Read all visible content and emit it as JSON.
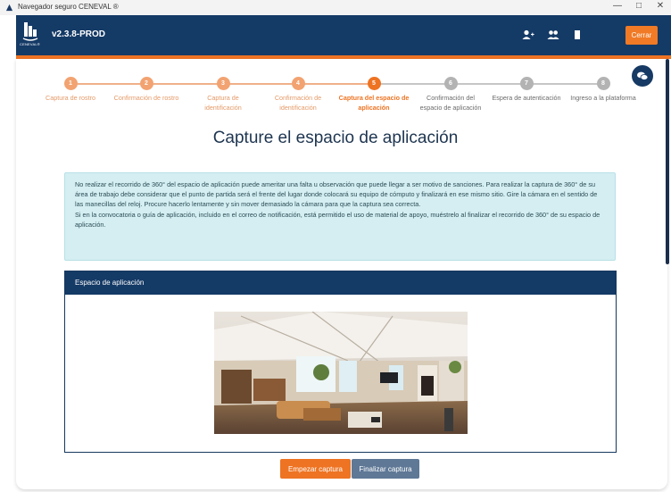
{
  "window": {
    "title": "Navegador seguro CENEVAL ®",
    "min_icon": "—",
    "restore_icon": "□",
    "close_icon": "✕"
  },
  "header": {
    "logo_text": "CENEVAL®",
    "version": "v2.3.8-PROD",
    "close_label": "Cerrar"
  },
  "steps": [
    {
      "number": "1",
      "label": "Captura de rostro",
      "status": "done"
    },
    {
      "number": "2",
      "label": "Confirmación de rostro",
      "status": "done"
    },
    {
      "number": "3",
      "label": "Captura de identificación",
      "status": "done"
    },
    {
      "number": "4",
      "label": "Confirmación de identificación",
      "status": "done"
    },
    {
      "number": "5",
      "label": "Captura del espacio de aplicación",
      "status": "active"
    },
    {
      "number": "6",
      "label": "Confirmación del espacio de aplicación",
      "status": "pending"
    },
    {
      "number": "7",
      "label": "Espera de autenticación",
      "status": "pending"
    },
    {
      "number": "8",
      "label": "Ingreso a la plataforma",
      "status": "pending"
    }
  ],
  "page_title": "Capture el espacio de aplicación",
  "alert": {
    "paragraph1": "No realizar el recorrido de 360° del espacio de aplicación puede ameritar una falta u observación que puede llegar a ser motivo de sanciones. Para realizar la captura de 360° de su área de trabajo debe considerar que el punto de partida será el frente del lugar donde colocará su equipo de cómputo y finalizará en ese mismo sitio. Gire la cámara en el sentido de las manecillas del reloj. Procure hacerlo lentamente y sin mover demasiado la cámara para que la captura sea correcta.",
    "paragraph2": "Si en la convocatoria o guía de aplicación, incluido en el correo de notificación, está permitido el uso de material de apoyo, muéstrelo al finalizar el recorrido de 360° de su espacio de aplicación."
  },
  "card": {
    "title": "Espacio de aplicación"
  },
  "buttons": {
    "start": "Empezar captura",
    "finish": "Finalizar captura"
  },
  "colors": {
    "navy": "#143a66",
    "orange": "#ee7322",
    "step_pending": "#b3b3b3",
    "alert_bg": "#d4eef2"
  },
  "icons": [
    "add-user-icon",
    "users-icon",
    "bookmark-icon",
    "chat-icon"
  ]
}
